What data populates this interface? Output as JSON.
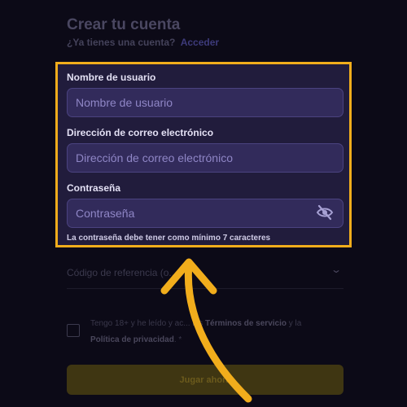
{
  "header": {
    "title": "Crear tu cuenta",
    "subtitle": "¿Ya tienes una cuenta?",
    "login_link": "Acceder"
  },
  "form": {
    "username": {
      "label": "Nombre de usuario",
      "placeholder": "Nombre de usuario",
      "value": ""
    },
    "email": {
      "label": "Dirección de correo electrónico",
      "placeholder": "Dirección de correo electrónico",
      "value": ""
    },
    "password": {
      "label": "Contraseña",
      "placeholder": "Contraseña",
      "value": "",
      "visibility_icon": "eye-slash-icon"
    },
    "password_hint": "La contraseña debe tener como mínimo 7 caracteres",
    "referral": {
      "label": "Código de referencia (o...",
      "icon": "chevron-down-icon"
    },
    "terms": {
      "prefix": "Tengo 18+ y he leído y ac... los",
      "terms_link": "Términos de servicio",
      "and": "y la",
      "privacy_link": "Política de privacidad",
      "suffix": ". *"
    },
    "submit_label": "Jugar ahora"
  },
  "colors": {
    "highlight_border": "#f1ad1c",
    "arrow": "#f1ad1c",
    "panel_bg": "#211c3c",
    "input_bg": "#322b5b"
  }
}
